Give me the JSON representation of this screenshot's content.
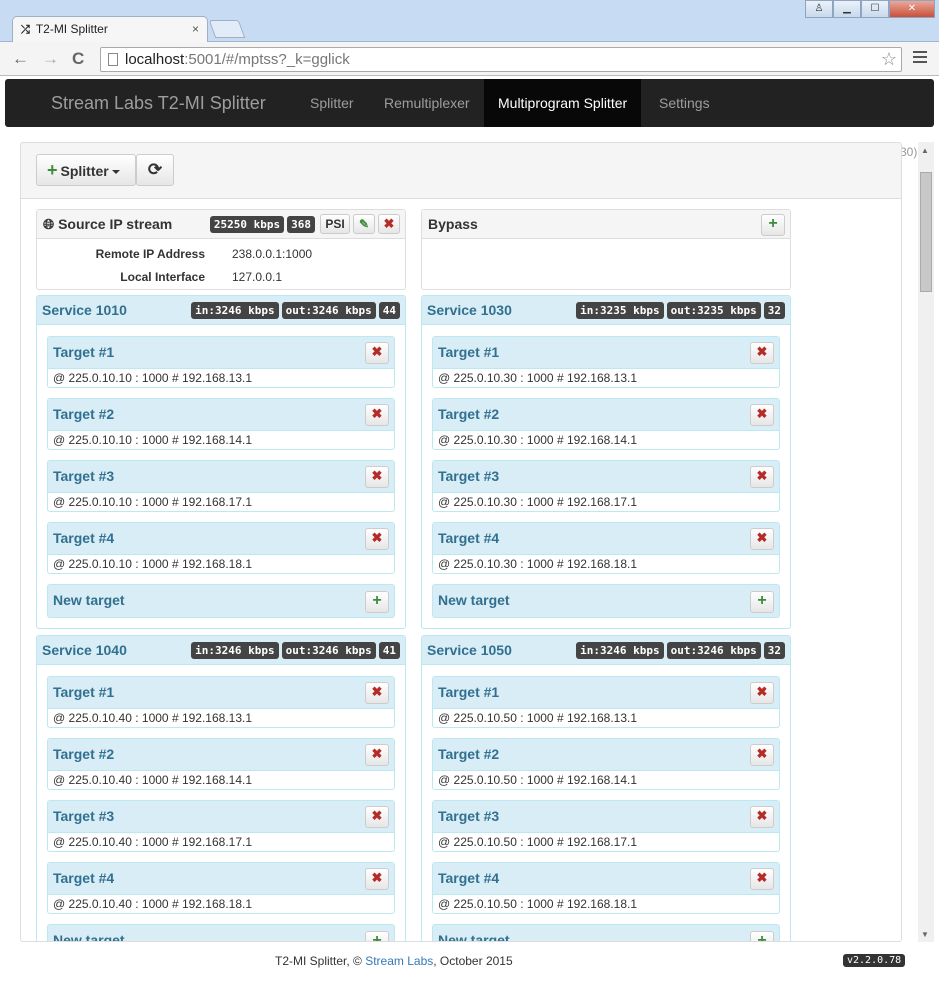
{
  "browser": {
    "tab_title": "T2-MI Splitter",
    "tab_close": "×",
    "url_host": "localhost",
    "url_rest": ":5001/#/mptss?_k=gglick",
    "back": "←",
    "forward": "→",
    "reload": "C",
    "star": "☆",
    "win_user": "♙",
    "win_min": "▁",
    "win_max": "☐",
    "win_close": "✕"
  },
  "nav": {
    "brand": "Stream Labs T2-MI Splitter",
    "items": [
      "Splitter",
      "Remultiplexer",
      "Multiprogram Splitter",
      "Settings"
    ],
    "active": "Multiprogram Splitter"
  },
  "toolbar": {
    "splitter_label": "Splitter",
    "plus": "+",
    "refresh": "⟳"
  },
  "peek_text": "30)",
  "source": {
    "title": "Source IP stream",
    "rate": "25250 kbps",
    "count": "368",
    "psi_label": "PSI",
    "edit_icon": "✎",
    "remove_icon": "✖",
    "rows": [
      {
        "label": "Remote IP Address",
        "value": "238.0.0.1:1000"
      },
      {
        "label": "Local Interface",
        "value": "127.0.0.1"
      }
    ]
  },
  "bypass": {
    "title": "Bypass",
    "add_icon": "+"
  },
  "services": [
    {
      "name": "Service 1010",
      "in_prefix": "in:",
      "in_rate": "3246 kbps",
      "out_prefix": "out:",
      "out_rate": "3246 kbps",
      "count": "44",
      "targets": [
        {
          "title": "Target #1",
          "addr": "@ 225.0.10.10 : 1000 # 192.168.13.1"
        },
        {
          "title": "Target #2",
          "addr": "@ 225.0.10.10 : 1000 # 192.168.14.1"
        },
        {
          "title": "Target #3",
          "addr": "@ 225.0.10.10 : 1000 # 192.168.17.1"
        },
        {
          "title": "Target #4",
          "addr": "@ 225.0.10.10 : 1000 # 192.168.18.1"
        }
      ],
      "new_target": "New target"
    },
    {
      "name": "Service 1030",
      "in_prefix": "in:",
      "in_rate": "3235 kbps",
      "out_prefix": "out:",
      "out_rate": "3235 kbps",
      "count": "32",
      "targets": [
        {
          "title": "Target #1",
          "addr": "@ 225.0.10.30 : 1000 # 192.168.13.1"
        },
        {
          "title": "Target #2",
          "addr": "@ 225.0.10.30 : 1000 # 192.168.14.1"
        },
        {
          "title": "Target #3",
          "addr": "@ 225.0.10.30 : 1000 # 192.168.17.1"
        },
        {
          "title": "Target #4",
          "addr": "@ 225.0.10.30 : 1000 # 192.168.18.1"
        }
      ],
      "new_target": "New target"
    },
    {
      "name": "Service 1040",
      "in_prefix": "in:",
      "in_rate": "3246 kbps",
      "out_prefix": "out:",
      "out_rate": "3246 kbps",
      "count": "41",
      "targets": [
        {
          "title": "Target #1",
          "addr": "@ 225.0.10.40 : 1000 # 192.168.13.1"
        },
        {
          "title": "Target #2",
          "addr": "@ 225.0.10.40 : 1000 # 192.168.14.1"
        },
        {
          "title": "Target #3",
          "addr": "@ 225.0.10.40 : 1000 # 192.168.17.1"
        },
        {
          "title": "Target #4",
          "addr": "@ 225.0.10.40 : 1000 # 192.168.18.1"
        }
      ],
      "new_target": "New target"
    },
    {
      "name": "Service 1050",
      "in_prefix": "in:",
      "in_rate": "3246 kbps",
      "out_prefix": "out:",
      "out_rate": "3246 kbps",
      "count": "32",
      "targets": [
        {
          "title": "Target #1",
          "addr": "@ 225.0.10.50 : 1000 # 192.168.13.1"
        },
        {
          "title": "Target #2",
          "addr": "@ 225.0.10.50 : 1000 # 192.168.14.1"
        },
        {
          "title": "Target #3",
          "addr": "@ 225.0.10.50 : 1000 # 192.168.17.1"
        },
        {
          "title": "Target #4",
          "addr": "@ 225.0.10.50 : 1000 # 192.168.18.1"
        }
      ],
      "new_target": "New target"
    }
  ],
  "footer": {
    "prefix": "T2-MI Splitter, © ",
    "link": "Stream Labs",
    "suffix": ", October 2015",
    "version": "v2.2.0.78"
  }
}
